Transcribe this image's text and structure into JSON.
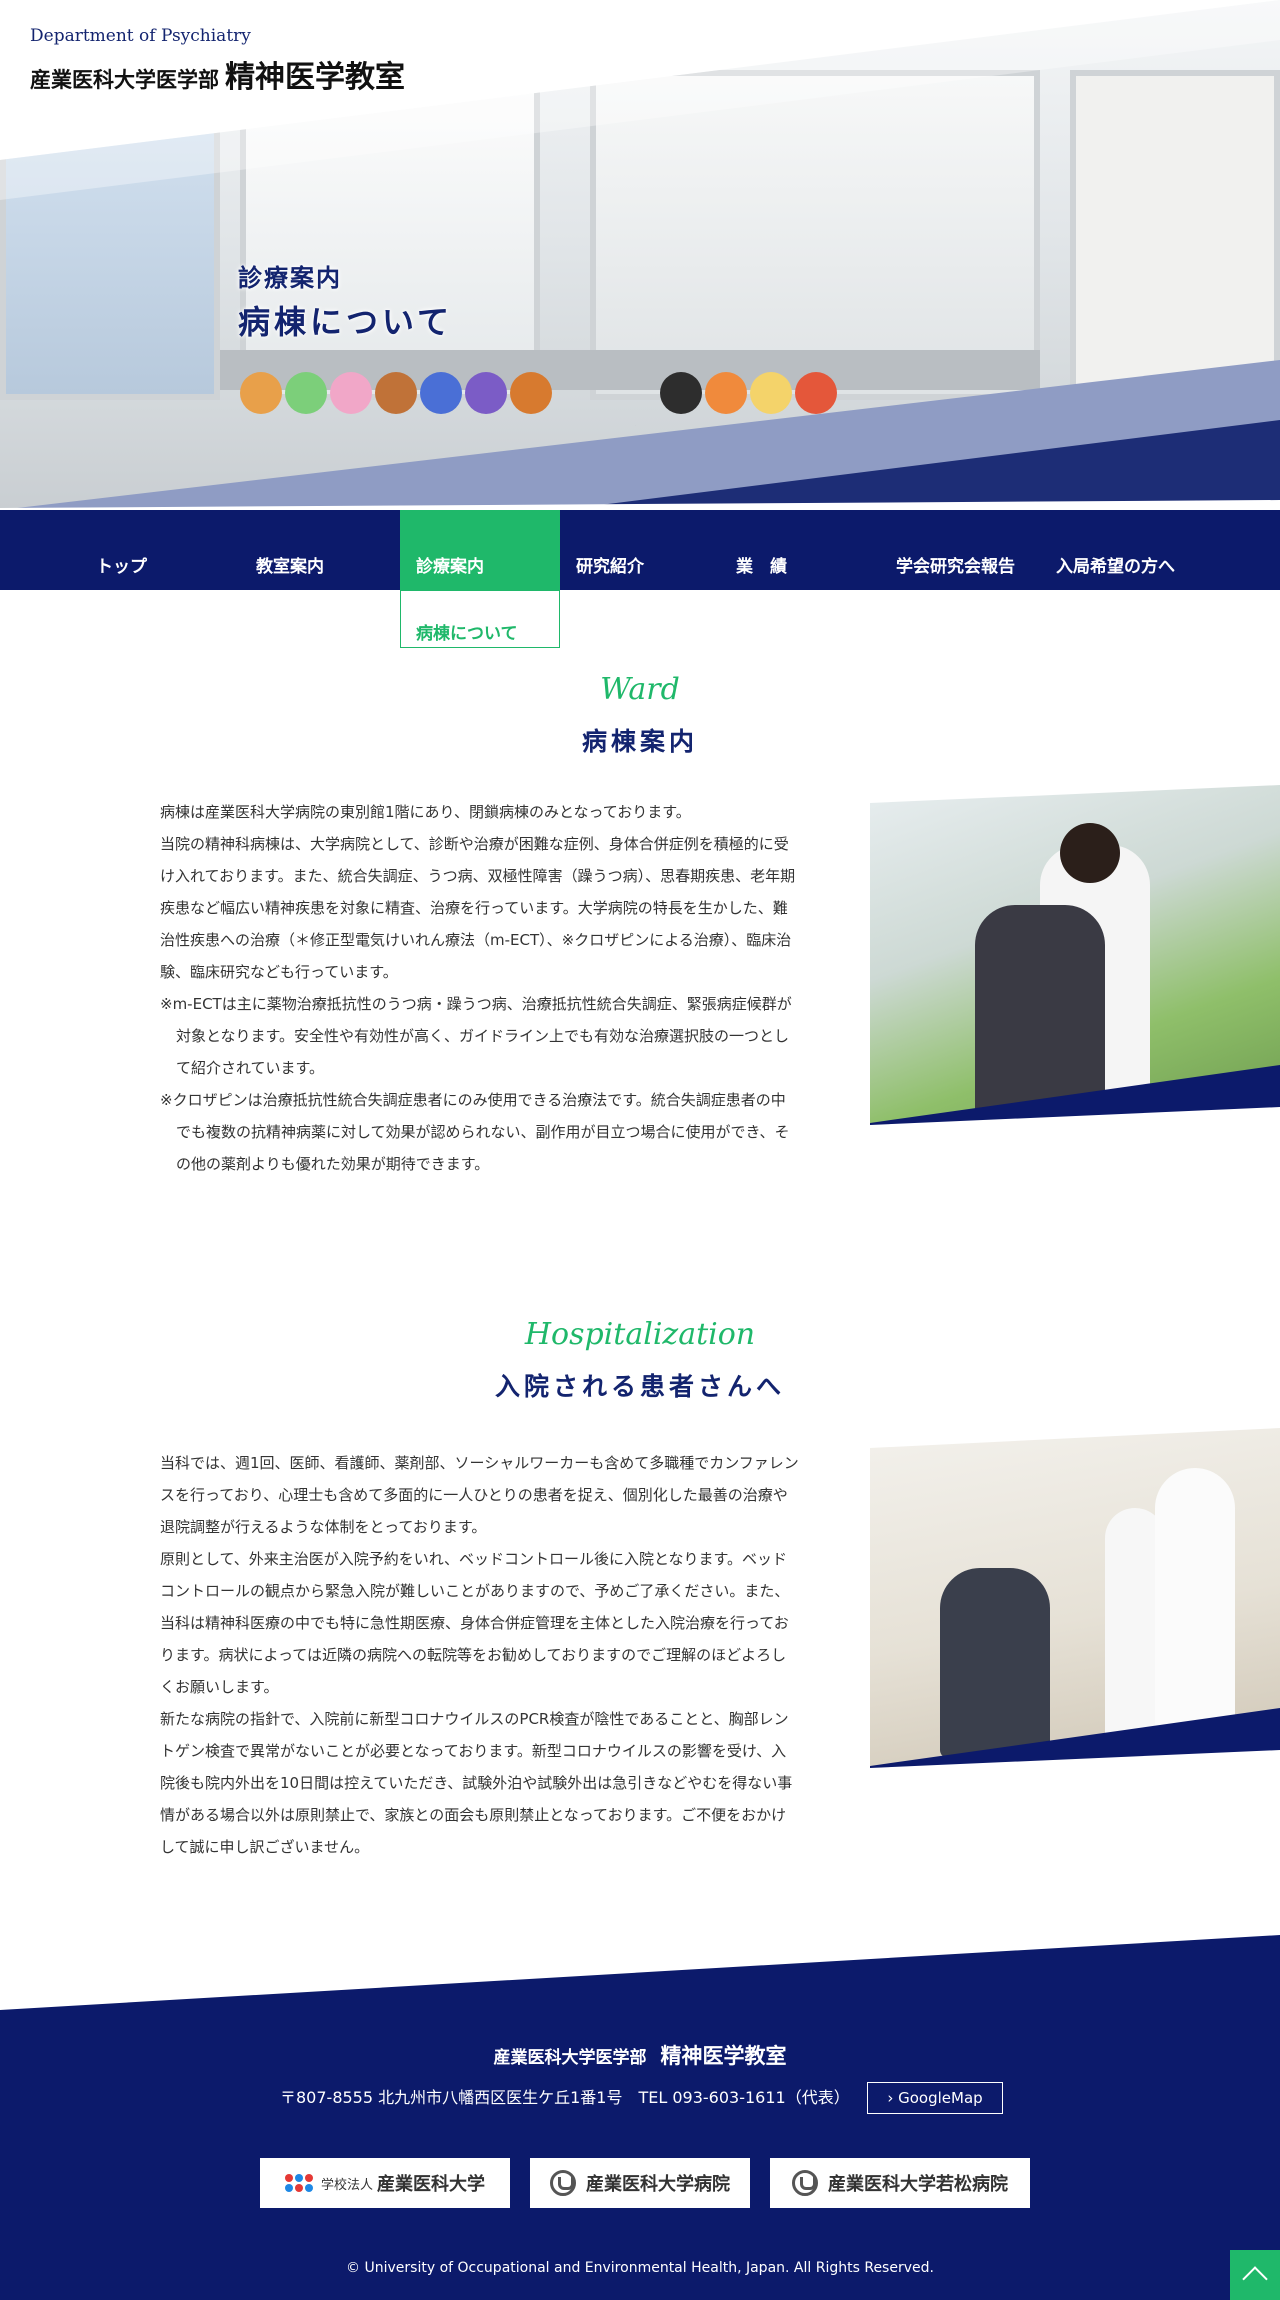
{
  "header": {
    "brand_en": "Department of Psychiatry",
    "brand_jp_small": "産業医科大学医学部",
    "brand_jp_big": "精神医学教室"
  },
  "hero": {
    "subtitle": "診療案内",
    "title": "病棟について"
  },
  "nav": {
    "items": [
      {
        "label": "トップ"
      },
      {
        "label": "教室案内"
      },
      {
        "label": "診療案内",
        "active": true
      },
      {
        "label": "研究紹介"
      },
      {
        "label": "業　績"
      },
      {
        "label": "学会研究会報告"
      },
      {
        "label": "入局希望の方へ"
      }
    ],
    "dropdown_label": "病棟について"
  },
  "ward": {
    "heading_en": "Ward",
    "heading_jp": "病棟案内",
    "paragraphs": [
      "病棟は産業医科大学病院の東別館1階にあり、閉鎖病棟のみとなっております。",
      "当院の精神科病棟は、大学病院として、診断や治療が困難な症例、身体合併症例を積極的に受け入れております。また、統合失調症、うつ病、双極性障害（躁うつ病）、思春期疾患、老年期疾患など幅広い精神疾患を対象に精査、治療を行っています。大学病院の特長を生かした、難治性疾患への治療（＊修正型電気けいれん療法（m-ECT）、※クロザピンによる治療）、臨床治験、臨床研究なども行っています。",
      "※m-ECTは主に薬物治療抵抗性のうつ病・躁うつ病、治療抵抗性統合失調症、緊張病症候群が対象となります。安全性や有効性が高く、ガイドライン上でも有効な治療選択肢の一つとして紹介されています。",
      "※クロザピンは治療抵抗性統合失調症患者にのみ使用できる治療法です。統合失調症患者の中でも複数の抗精神病薬に対して効果が認められない、副作用が目立つ場合に使用ができ、その他の薬剤よりも優れた効果が期待できます。"
    ]
  },
  "hospitalization": {
    "heading_en": "Hospitalization",
    "heading_jp": "入院される患者さんへ",
    "paragraphs": [
      "当科では、週1回、医師、看護師、薬剤部、ソーシャルワーカーも含めて多職種でカンファレンスを行っており、心理士も含めて多面的に一人ひとりの患者を捉え、個別化した最善の治療や退院調整が行えるような体制をとっております。",
      "原則として、外来主治医が入院予約をいれ、ベッドコントロール後に入院となります。ベッドコントロールの観点から緊急入院が難しいことがありますので、予めご了承ください。また、当科は精神科医療の中でも特に急性期医療、身体合併症管理を主体とした入院治療を行っております。病状によっては近隣の病院への転院等をお勧めしておりますのでご理解のほどよろしくお願いします。",
      "新たな病院の指針で、入院前に新型コロナウイルスのPCR検査が陰性であることと、胸部レントゲン検査で異常がないことが必要となっております。新型コロナウイルスの影響を受け、入院後も院内外出を10日間は控えていただき、試験外泊や試験外出は急引きなどやむを得ない事情がある場合以外は原則禁止で、家族との面会も原則禁止となっております。ご不便をおかけして誠に申し訳ございません。"
    ]
  },
  "footer": {
    "name_small": "産業医科大学医学部",
    "name_big": "精神医学教室",
    "address": "〒807-8555 北九州市八幡西区医生ケ丘1番1号　TEL 093-603-1611（代表）",
    "map_label": "GoogleMap",
    "banners": [
      {
        "prefix": "学校法人",
        "label": "産業医科大学"
      },
      {
        "label": "産業医科大学病院"
      },
      {
        "label": "産業医科大学若松病院"
      }
    ],
    "copyright": "© University of Occupational and Environmental Health, Japan. All Rights Reserved."
  },
  "colors": {
    "navy": "#0c1a6b",
    "green": "#1fb86a"
  }
}
